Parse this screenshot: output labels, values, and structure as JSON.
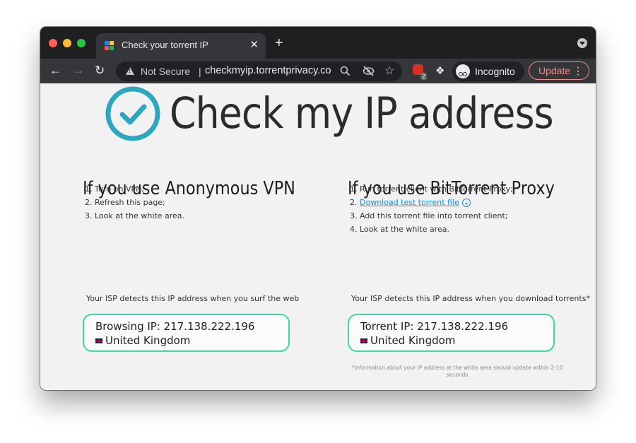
{
  "browser": {
    "tab": {
      "title": "Check your torrent IP"
    },
    "new_tab_symbol": "+",
    "close_symbol": "✕",
    "address_bar": {
      "security_label": "Not Secure",
      "separator": "|",
      "url": "checkmyip.torrentprivacy.com"
    },
    "extension_badge_count": "2",
    "incognito_label": "Incognito",
    "update_label": "Update",
    "menu_symbol": "⋮"
  },
  "page": {
    "hero_title": "Check my IP address",
    "vpn": {
      "title": "If you use Anonymous VPN",
      "steps": [
        "1. Turn on VPN;",
        "2. Refresh this page;",
        "3. Look at the white area."
      ],
      "isp_note": "Your ISP detects this IP address when you surf the web",
      "ip_line": "Browsing IP: 217.138.222.196",
      "country": "United Kingdom"
    },
    "proxy": {
      "title": "If you use BitTorrent Proxy",
      "step1": "1. Run torrent client with BitTorrent Proxy;",
      "step2_prefix": "2. ",
      "step2_link": "Download test torrent file",
      "step3": "3. Add this torrent file into torrent client;",
      "step4": "4. Look at the white area.",
      "isp_note": "Your ISP detects this IP address when you download torrents*",
      "ip_line": "Torrent IP: 217.138.222.196",
      "country": "United Kingdom"
    },
    "footnote": "*Information about your IP address at the white area should update within 2-10 seconds"
  },
  "colors": {
    "accent_teal": "#2fa6c0",
    "box_border": "#3bd9a6",
    "link": "#1a8dd8",
    "update_red": "#f28b82"
  }
}
